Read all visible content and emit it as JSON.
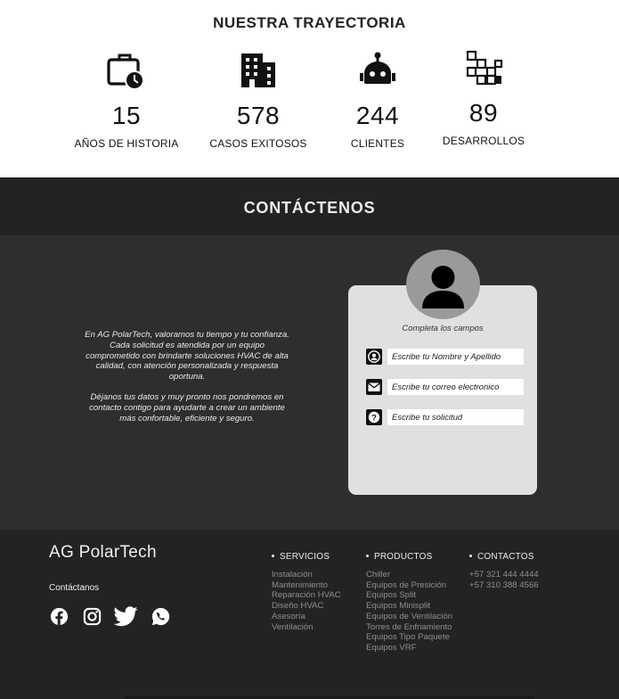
{
  "trajectory": {
    "title": "NUESTRA TRAYECTORIA",
    "stats": [
      {
        "icon": "briefcase-clock-icon",
        "value": "15",
        "label": "AÑOS DE HISTORIA"
      },
      {
        "icon": "building-icon",
        "value": "578",
        "label": "CASOS EXITOSOS"
      },
      {
        "icon": "robot-icon",
        "value": "244",
        "label": "CLIENTES"
      },
      {
        "icon": "blocks-icon",
        "value": "89",
        "label": "DESARROLLOS"
      }
    ]
  },
  "contact": {
    "title": "CONTÁCTENOS",
    "intro_p1": "En AG PolarTech, valoramos tu tiempo y tu confianza. Cada solicitud es atendida por un equipo comprometido con brindarte soluciones HVAC de alta calidad, con atención personalizada y respuesta oportuna.",
    "intro_p2": "Déjanos tus datos y muy pronto nos pondremos en contacto contigo para ayudarte a crear un ambiente más confortable, eficiente y seguro.",
    "form": {
      "hint": "Completa los campos",
      "name_placeholder": "Escribe tu Nombre y Apellido",
      "email_placeholder": "Escribe tu correo electronico",
      "request_placeholder": "Escribe tu solicitud"
    }
  },
  "footer": {
    "brand": "AG PolarTech",
    "contact_link": "Contáctanos",
    "socials": [
      "facebook-icon",
      "instagram-icon",
      "twitter-icon",
      "whatsapp-icon"
    ],
    "servicios": {
      "title": "SERVICIOS",
      "items": [
        "Instalación",
        "Mantenimiento",
        "Reparación HVAC",
        "Diseño HVAC",
        "Asesoría",
        "Ventilación"
      ]
    },
    "productos": {
      "title": "PRODUCTOS",
      "items": [
        "Chiller",
        "Equipos de Presición",
        "Equipos Split",
        "Equipos Minisplit",
        "Equipos de Ventilación",
        "Torres de Enfriamiento",
        "Equipos Tipo Paquete",
        "Equipos VRF"
      ]
    },
    "contactos": {
      "title": "CONTACTOS",
      "items": [
        "+57 321 444 4444",
        "+57 310 388 4566"
      ]
    }
  }
}
